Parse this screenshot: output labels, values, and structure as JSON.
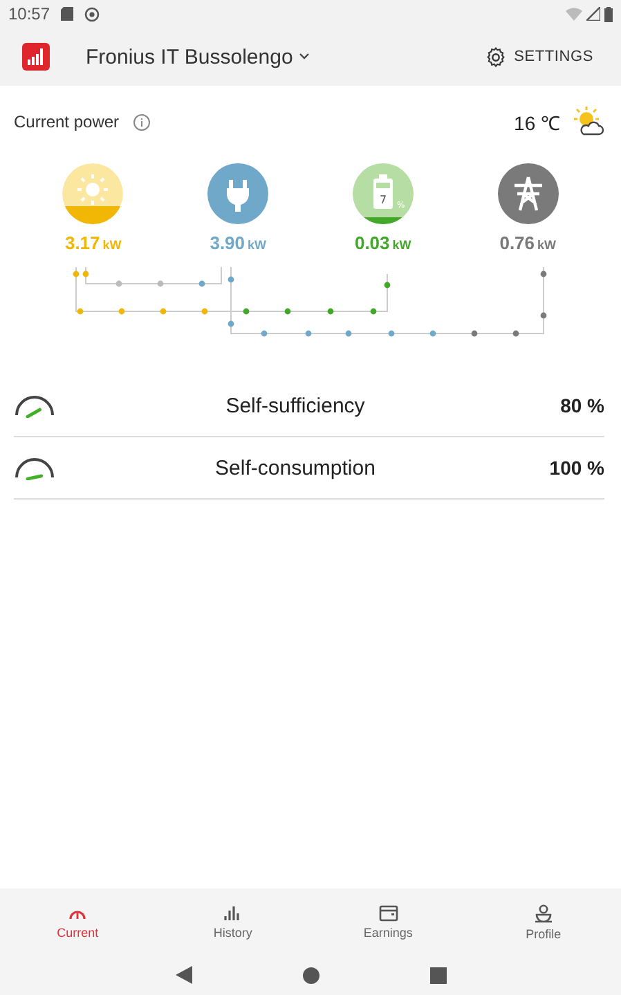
{
  "status_bar": {
    "time": "10:57"
  },
  "app_bar": {
    "plant": "Fronius IT Bussolengo",
    "settings": "SETTINGS"
  },
  "header": {
    "title": "Current power",
    "temperature": "16 ℃"
  },
  "nodes": [
    {
      "kind": "solar",
      "value": "3.17",
      "unit": "kW",
      "color": "#f2b705"
    },
    {
      "kind": "load",
      "value": "3.90",
      "unit": "kW",
      "color": "#6fa8c8"
    },
    {
      "kind": "battery",
      "value": "0.03",
      "unit": "kW",
      "color": "#43a72a",
      "charge": "7",
      "charge_unit": "%"
    },
    {
      "kind": "grid",
      "value": "0.76",
      "unit": "kW",
      "color": "#7a7a7a"
    }
  ],
  "metrics": [
    {
      "label": "Self-sufficiency",
      "value": "80 %"
    },
    {
      "label": "Self-consumption",
      "value": "100 %"
    }
  ],
  "tabs": [
    {
      "kind": "current",
      "label": "Current",
      "selected": true
    },
    {
      "kind": "history",
      "label": "History",
      "selected": false
    },
    {
      "kind": "earnings",
      "label": "Earnings",
      "selected": false
    },
    {
      "kind": "profile",
      "label": "Profile",
      "selected": false
    }
  ]
}
